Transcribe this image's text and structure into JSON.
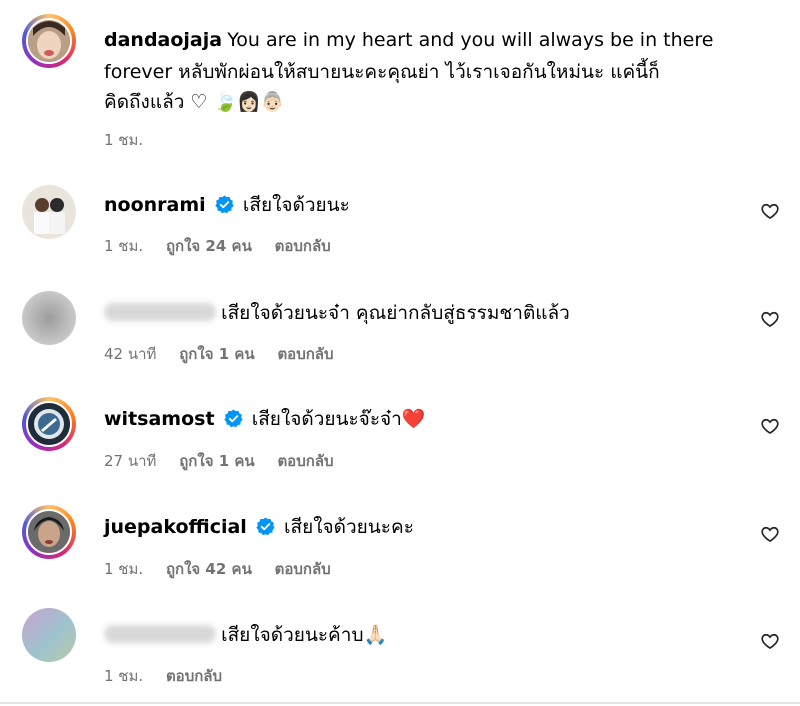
{
  "post_caption": {
    "username": "dandaojaja",
    "text_line1": "You are in my heart and you will always be in there",
    "text_line2": "forever หลับพักผ่อนให้สบายนะคะคุณย่า ไว้เราเจอกันใหม่นะ แค่นี้ก็",
    "text_line3": "คิดถึงแล้ว ♡ 🍃👩🏻👵🏻",
    "time": "1 ชม."
  },
  "comments": [
    {
      "username": "noonrami",
      "verified": true,
      "text": "เสียใจด้วยนะ",
      "time": "1 ชม.",
      "likes": "ถูกใจ 24 คน",
      "reply": "ตอบกลับ"
    },
    {
      "username": "",
      "verified": false,
      "text": "เสียใจด้วยนะจ๋า คุณย่ากลับสู่ธรรมชาติแล้ว",
      "time": "42 นาที",
      "likes": "ถูกใจ 1 คน",
      "reply": "ตอบกลับ"
    },
    {
      "username": "witsamost",
      "verified": true,
      "text": "เสียใจด้วยนะจ๊ะจ๋า❤️",
      "time": "27 นาที",
      "likes": "ถูกใจ 1 คน",
      "reply": "ตอบกลับ"
    },
    {
      "username": "juepakofficial",
      "verified": true,
      "text": "เสียใจด้วยนะคะ",
      "time": "1 ชม.",
      "likes": "ถูกใจ 42 คน",
      "reply": "ตอบกลับ"
    },
    {
      "username": "",
      "verified": false,
      "text": "เสียใจด้วยนะค้าบ🙏🏻",
      "time": "1 ชม.",
      "reply": "ตอบกลับ"
    }
  ],
  "colors": {
    "verified": "#0095f6",
    "meta": "#737373",
    "heart_red": "#e0162b"
  }
}
